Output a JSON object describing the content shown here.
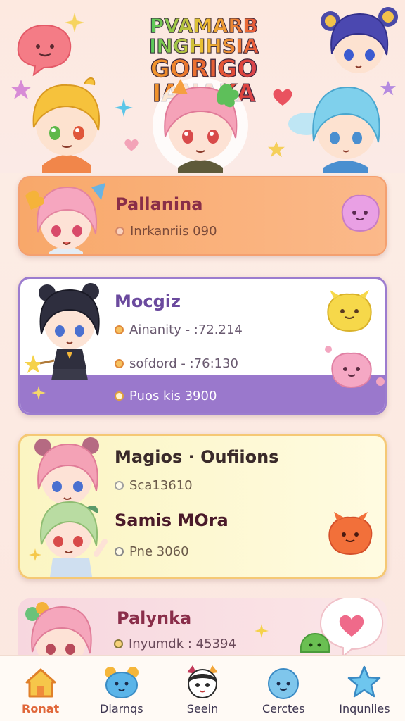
{
  "header": {
    "title_line1": "PVAMARB INGHHSIA",
    "title_line2": "GORIGO IANAKA"
  },
  "cards": [
    {
      "name": "Pallanina",
      "rows": [
        "Inrkanriis 090"
      ]
    },
    {
      "name": "Mocgiz",
      "rows": [
        "Ainanity - :72.214",
        "sofdord - :76:130"
      ],
      "footer": "Puos kis 3900"
    },
    {
      "name": "Magios · Oufiions",
      "rows": [
        "Sca13610"
      ],
      "name2": "Samis MOra",
      "rows2": [
        "Pne 3060"
      ]
    },
    {
      "name": "Palynka",
      "rows": [
        "Inyumdk : 45394"
      ]
    }
  ],
  "nav": [
    {
      "label": "Ronat",
      "icon": "home-icon",
      "active": true
    },
    {
      "label": "Dlarnqs",
      "icon": "blue-creature-icon"
    },
    {
      "label": "Seein",
      "icon": "panda-icon"
    },
    {
      "label": "Cerctes",
      "icon": "blue-face-icon"
    },
    {
      "label": "Inquniies",
      "icon": "star-icon"
    }
  ],
  "colors": {
    "accent_orange": "#e0673a",
    "card1": "#f8a86a",
    "card2_border": "#9c7ccf",
    "card3_border": "#f5c874"
  }
}
